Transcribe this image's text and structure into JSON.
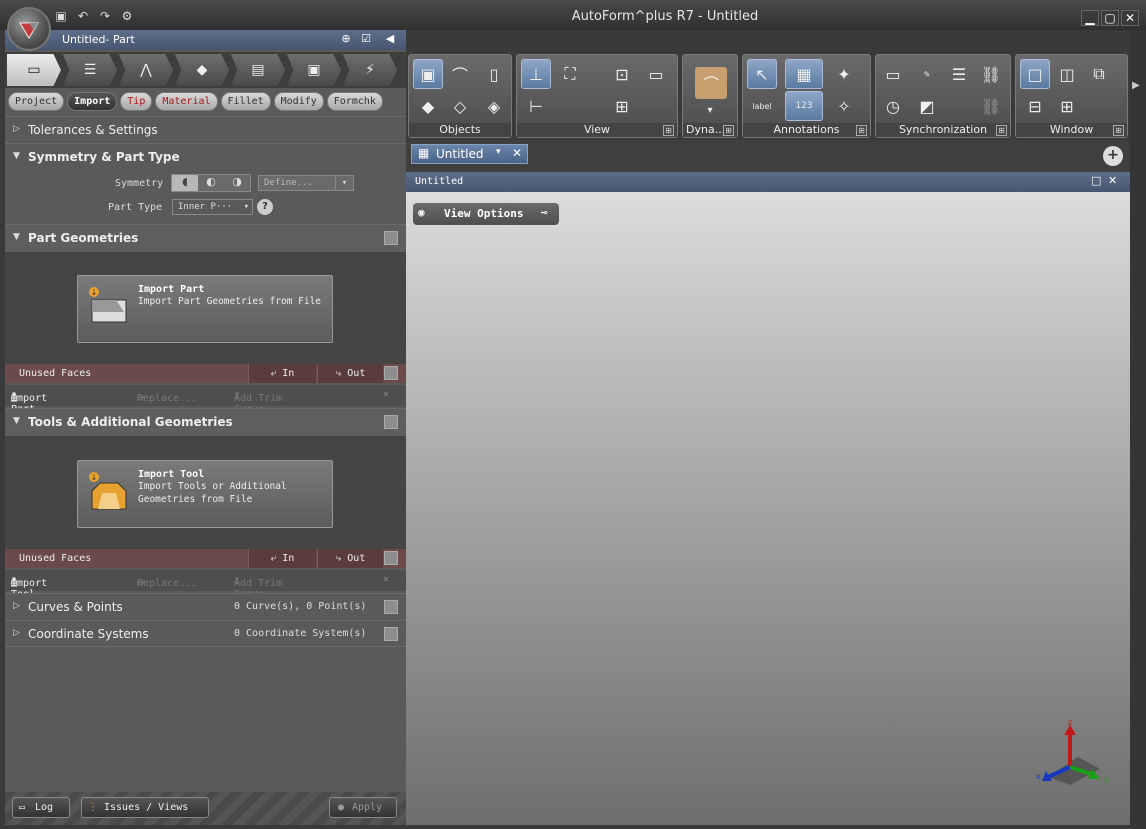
{
  "window": {
    "title": "AutoForm^plus R7 - Untitled"
  },
  "quick_access": {
    "icons": [
      "save-icon",
      "undo-icon",
      "redo-icon",
      "settings-icon"
    ]
  },
  "left_panel": {
    "header_title": "Untitled- Part",
    "tabs": [
      {
        "label": "Project",
        "style": "normal"
      },
      {
        "label": "Import",
        "style": "active"
      },
      {
        "label": "Tip",
        "style": "red"
      },
      {
        "label": "Material",
        "style": "red"
      },
      {
        "label": "Fillet",
        "style": "normal"
      },
      {
        "label": "Modify",
        "style": "normal"
      },
      {
        "label": "Formchk",
        "style": "normal"
      }
    ],
    "tolerances": "Tolerances & Settings",
    "symmetry_section": "Symmetry & Part Type",
    "symmetry_label": "Symmetry",
    "define_placeholder": "Define...",
    "part_type_label": "Part Type",
    "part_type_value": "Inner P···",
    "help": "?",
    "part_geometries": "Part Geometries",
    "import_part_title": "Import Part",
    "import_part_desc": "Import Part Geometries from File",
    "unused_faces_1": "Unused Faces",
    "in_1": "In",
    "out_1": "Out",
    "import_part_menu": "Import Part...",
    "replace_1": "Replace...",
    "add_trim_1": "Add Trim Curve...",
    "tools_section": "Tools & Additional Geometries",
    "import_tool_title": "Import Tool",
    "import_tool_desc": "Import Tools or Additional Geometries from File",
    "unused_faces_2": "Unused Faces",
    "in_2": "In",
    "out_2": "Out",
    "import_tool_menu": "Import Tool...",
    "replace_2": "Replace...",
    "add_trim_2": "Add Trim Curve...",
    "curves_points": "Curves & Points",
    "curves_count": "0 Curve(s), 0 Point(s)",
    "coord_systems": "Coordinate Systems",
    "coord_count": "0 Coordinate System(s)",
    "log_button": "Log",
    "issues_button": "Issues / Views",
    "apply_button": "Apply"
  },
  "ribbon": {
    "groups": [
      "Objects",
      "View",
      "Dyna...",
      "Annotations",
      "Synchronization",
      "Window"
    ],
    "annotation_label": "label",
    "number_value": "123"
  },
  "document": {
    "tab_title": "Untitled",
    "view_title": "Untitled",
    "view_options": "View Options",
    "axes": {
      "x": "x",
      "y": "y",
      "z": "z"
    }
  },
  "colors": {
    "accent": "#5d6e8a",
    "warning": "#6b4a4a",
    "viewport": "#b9b9b9"
  }
}
